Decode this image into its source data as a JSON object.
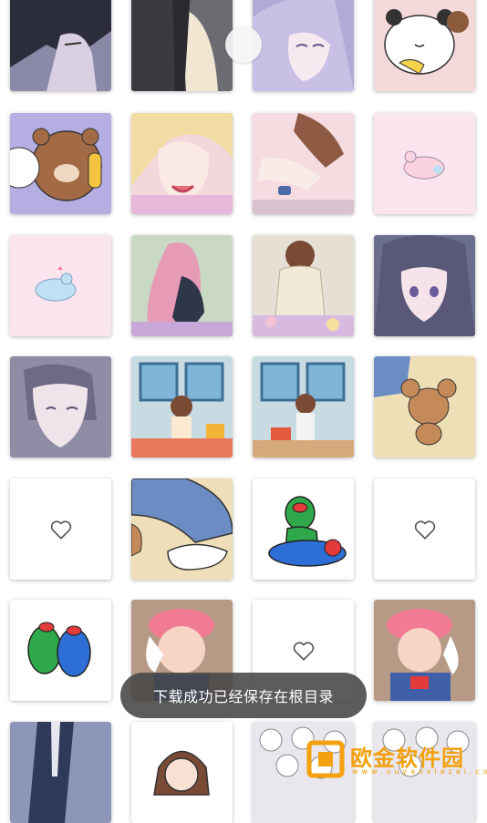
{
  "gallery": {
    "tiles": [
      {
        "art": "anime-boy-dark"
      },
      {
        "art": "anime-girl-long-hair"
      },
      {
        "art": "anime-girl-smiling"
      },
      {
        "art": "panda-bear-sticker"
      },
      {
        "art": "bear-corn-sticker"
      },
      {
        "art": "anime-girl-laughing"
      },
      {
        "art": "anime-couple"
      },
      {
        "art": "pink-creature-sticker"
      },
      {
        "art": "blue-creature-sticker"
      },
      {
        "art": "pink-hair-girl"
      },
      {
        "art": "boy-back-view"
      },
      {
        "art": "anime-girl-purple"
      },
      {
        "art": "anime-boy-wink"
      },
      {
        "art": "painted-girl-shop"
      },
      {
        "art": "painted-boy-shop"
      },
      {
        "art": "cartoon-mouse"
      },
      {
        "art": "placeholder"
      },
      {
        "art": "cartoon-cat-paw"
      },
      {
        "art": "green-blue-frogs"
      },
      {
        "art": "placeholder"
      },
      {
        "art": "green-blue-hug"
      },
      {
        "art": "baby-pink-hat"
      },
      {
        "art": "placeholder"
      },
      {
        "art": "baby-pink-hat-2"
      },
      {
        "art": "suit-figure"
      },
      {
        "art": "cartoon-girl-bob"
      },
      {
        "art": "doodle-pattern"
      },
      {
        "art": "doodle-pattern-2"
      }
    ]
  },
  "toast": {
    "message": "下载成功已经保存在根目录"
  },
  "watermark": {
    "brand": "欧金软件园",
    "url": "www.ouyaoxiazai.com"
  },
  "colors": {
    "watermark": "#f3a10e",
    "toast_bg": "#464646"
  }
}
